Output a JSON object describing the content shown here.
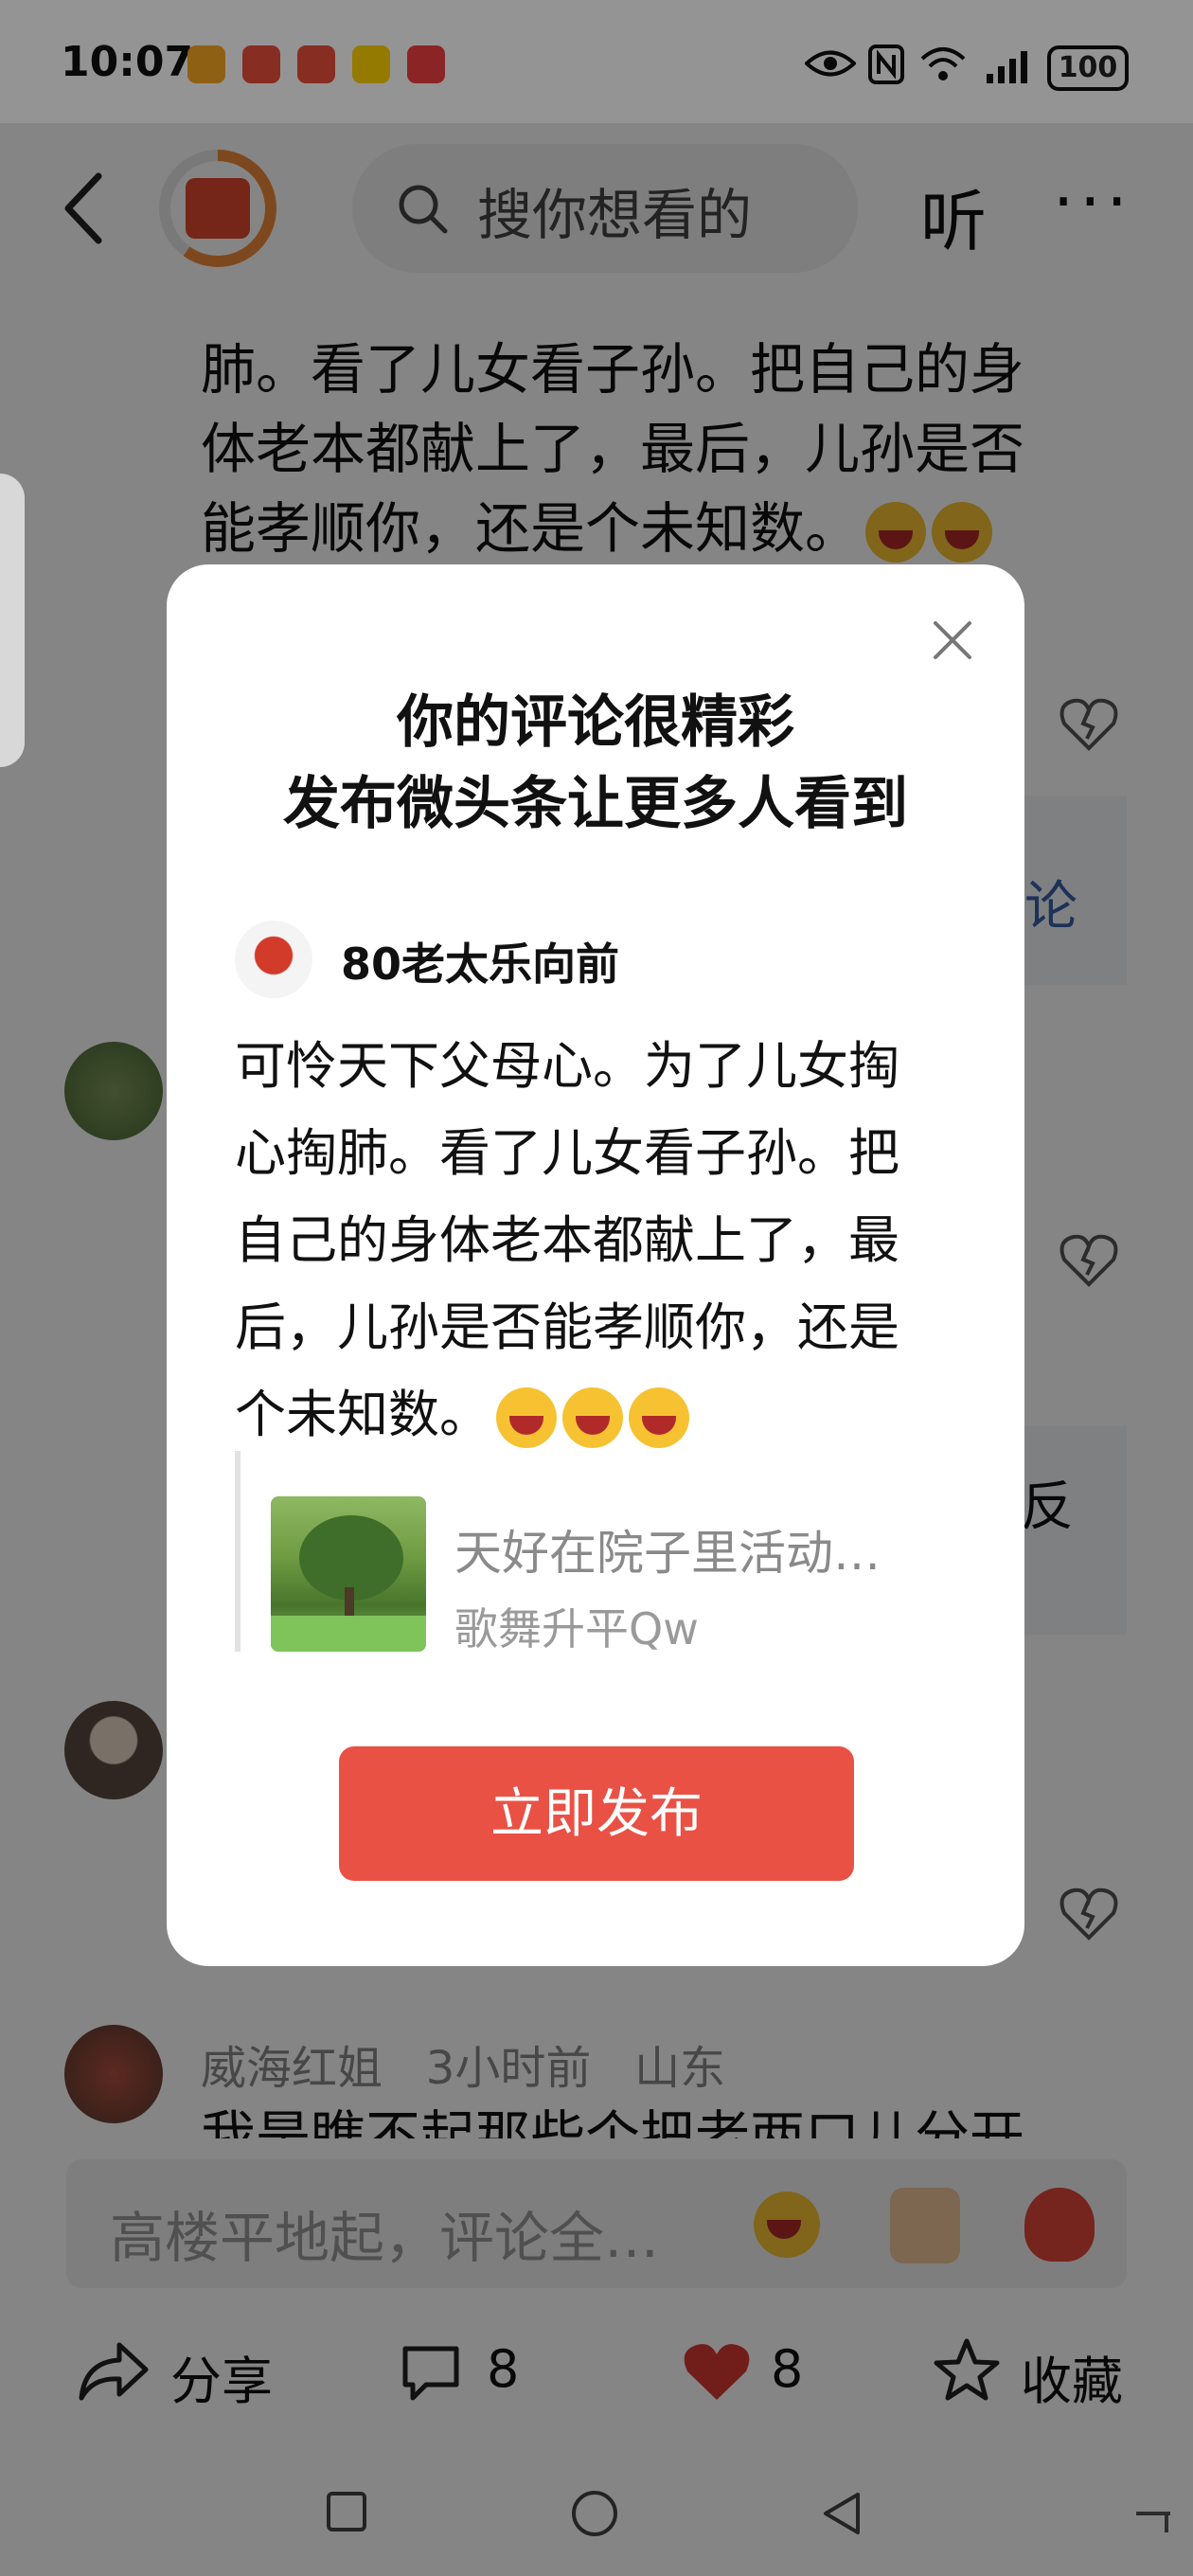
{
  "status_bar": {
    "time": "10:07",
    "battery": "100",
    "icons": [
      "wallet-app-icon",
      "game-app-icon",
      "game-app-icon",
      "meituan-app-icon",
      "mail-app-icon",
      "eye-icon",
      "nfc-icon",
      "wifi-6-icon",
      "signal-icon"
    ]
  },
  "top_bar": {
    "search_placeholder": "搜你想看的",
    "listen_label": "听",
    "more_label": "···"
  },
  "background": {
    "comment_lines": [
      "肺。看了儿女看子孙。把自己的身",
      "体老本都献上了，最后，儿孙是否",
      "能孝顺你，还是个未知数。"
    ],
    "partial_word_1": "论",
    "partial_word_2": "反",
    "last_comment": {
      "author": "威海红姐",
      "time": "3小时前",
      "location": "山东",
      "text_partial": "我是瞧不起那些个把老两口儿分开"
    },
    "input_placeholder": "高楼平地起，评论全…",
    "actions": {
      "share_label": "分享",
      "comment_count": "8",
      "like_count": "8",
      "collect_label": "收藏"
    }
  },
  "modal": {
    "title_line1": "你的评论很精彩",
    "title_line2": "发布微头条让更多人看到",
    "user_name": "80老太乐向前",
    "post_lines": [
      "可怜天下父母心。为了儿女掏",
      "心掏肺。看了儿女看子孙。把",
      "自己的身体老本都献上了，最",
      "后，儿孙是否能孝顺你，还是",
      "个未知数。"
    ],
    "quote_title": "天好在院子里活动…",
    "quote_author": "歌舞升平Qw",
    "publish_label": "立即发布"
  },
  "colors": {
    "publish_button": "#ea5145",
    "heart": "#d83a32",
    "overlay": "rgba(0,0,0,0.48)"
  }
}
